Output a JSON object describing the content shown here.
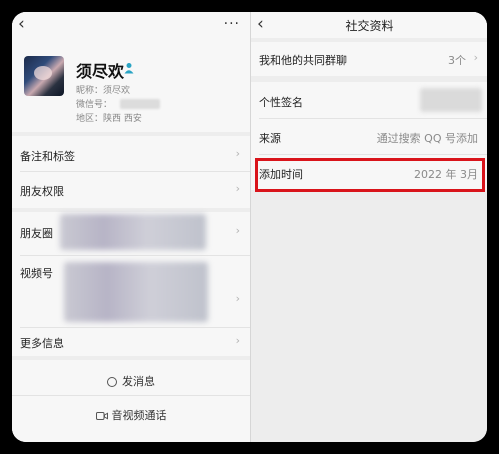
{
  "left": {
    "back_glyph": "‹",
    "more_glyph": "···",
    "profile": {
      "name": "须尽欢",
      "nickname": "昵称：须尽欢",
      "wechat_id_label": "微信号：",
      "region": "地区：陕西 西安"
    },
    "rows": {
      "remarks": "备注和标签",
      "permissions": "朋友权限",
      "moments": "朋友圈",
      "channels": "视频号",
      "more_info": "更多信息"
    },
    "actions": {
      "message": "发消息",
      "video_call": "音视频通话"
    }
  },
  "right": {
    "title": "社交资料",
    "back_glyph": "‹",
    "rows": {
      "common_groups_label": "我和他的共同群聊",
      "common_groups_value": "3个",
      "signature_label": "个性签名",
      "source_label": "来源",
      "source_value": "通过搜索 QQ 号添加",
      "added_label": "添加时间",
      "added_value": "2022 年 3月"
    }
  },
  "chevron_glyph": "›",
  "colors": {
    "highlight": "#d9141b",
    "background": "#ededed",
    "card": "#f7f7f7",
    "badge": "#2aa4c4"
  }
}
